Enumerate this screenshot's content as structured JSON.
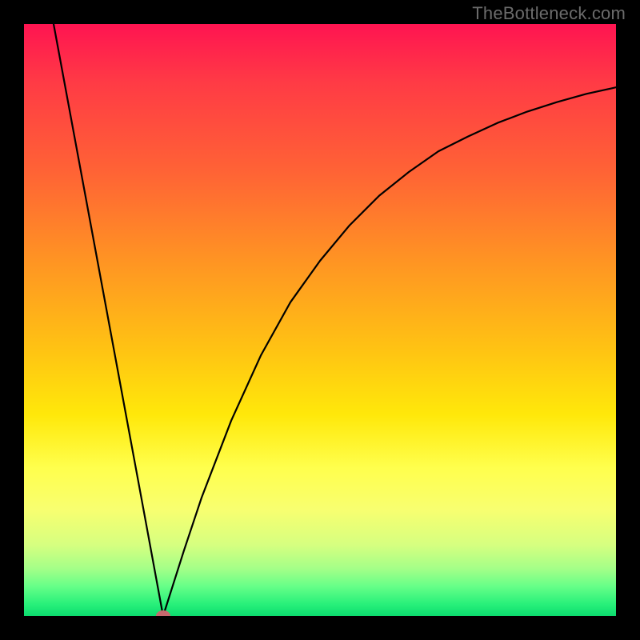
{
  "watermark": "TheBottleneck.com",
  "chart_data": {
    "type": "line",
    "title": "",
    "xlabel": "",
    "ylabel": "",
    "xlim": [
      0,
      1
    ],
    "ylim": [
      0,
      1
    ],
    "grid": false,
    "colors": {
      "curve": "#000000",
      "marker": "#C7696E",
      "bg_top": "#FF1451",
      "bg_mid": "#FFE80A",
      "bg_bottom": "#0CDC6E"
    },
    "marker": {
      "x": 0.235,
      "y": 0.0
    },
    "series": [
      {
        "name": "left-leg",
        "x": [
          0.05,
          0.1,
          0.15,
          0.2,
          0.235
        ],
        "y": [
          1.0,
          0.73,
          0.46,
          0.19,
          0.0
        ]
      },
      {
        "name": "right-leg",
        "x": [
          0.235,
          0.27,
          0.3,
          0.35,
          0.4,
          0.45,
          0.5,
          0.55,
          0.6,
          0.65,
          0.7,
          0.75,
          0.8,
          0.85,
          0.9,
          0.95,
          1.0
        ],
        "y": [
          0.0,
          0.11,
          0.2,
          0.33,
          0.44,
          0.53,
          0.6,
          0.66,
          0.71,
          0.75,
          0.785,
          0.81,
          0.833,
          0.852,
          0.868,
          0.882,
          0.893
        ]
      }
    ]
  }
}
